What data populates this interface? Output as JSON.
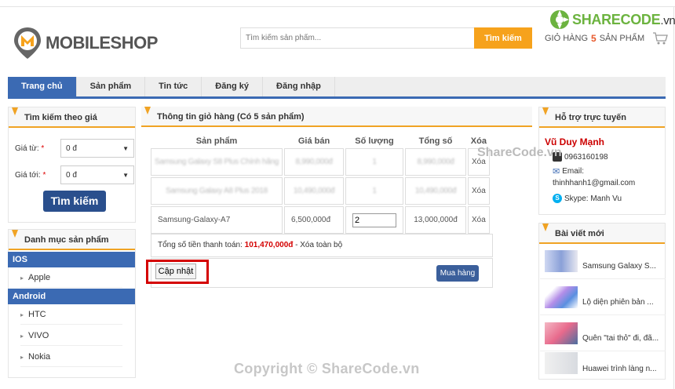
{
  "header": {
    "logo_text": "MOBILESHOP",
    "search_placeholder": "Tìm kiếm sản phẩm...",
    "search_button": "Tìm kiếm",
    "cart_prefix": "GIỎ HÀNG",
    "cart_count": "5",
    "cart_suffix": "SẢN PHẨM"
  },
  "sharecode": {
    "brand": "SHARECODE",
    "tld": ".vn"
  },
  "nav": [
    "Trang chủ",
    "Sản phẩm",
    "Tin tức",
    "Đăng ký",
    "Đăng nhập"
  ],
  "price_search": {
    "title": "Tìm kiếm theo giá",
    "from_label": "Giá từ:",
    "to_label": "Giá tới:",
    "required": "*",
    "from_value": "0 đ",
    "to_value": "0 đ",
    "button": "Tìm kiếm"
  },
  "categories": {
    "title": "Danh mục sản phẩm",
    "groups": [
      {
        "name": "IOS",
        "items": [
          "Apple"
        ]
      },
      {
        "name": "Android",
        "items": [
          "HTC",
          "VIVO",
          "Nokia"
        ]
      }
    ]
  },
  "cart": {
    "title": "Thông tin giỏ hàng (Có 5 sản phẩm)",
    "headers": [
      "Sản phẩm",
      "Giá bán",
      "Số lượng",
      "Tổng số",
      "Xóa"
    ],
    "rows": [
      {
        "product": "Samsung Galaxy S8 Plus Chính hãng",
        "price": "8,990,000đ",
        "qty": "1",
        "total": "8,990,000đ",
        "del": "Xóa"
      },
      {
        "product": "Samsung Galaxy A8 Plus 2018",
        "price": "10,490,000đ",
        "qty": "1",
        "total": "10,490,000đ",
        "del": "Xóa"
      },
      {
        "product": "Samsung-Galaxy-A7",
        "price": "6,500,000đ",
        "qty": "2",
        "total": "13,000,000đ",
        "del": "Xóa"
      }
    ],
    "total_label": "Tổng số tiền thanh toán:",
    "total_value": "101,470,000đ",
    "clear_all": "- Xóa toàn bộ",
    "update_button": "Cập nhật",
    "buy_button": "Mua hàng"
  },
  "support": {
    "title": "Hỗ trợ trực tuyến",
    "name": "Vũ Duy Mạnh",
    "phone": "0963160198",
    "email_label": "Email:",
    "email": "thinhhanh1@gmail.com",
    "skype": "Skype: Manh Vu"
  },
  "news": {
    "title": "Bài viết mới",
    "items": [
      "Samsung Galaxy S...",
      "Lộ diện phiên bản ...",
      "Quên \"tai thỏ\" đi, đã...",
      "Huawei trình làng n..."
    ]
  },
  "watermark": "Copyright © ShareCode.vn",
  "watermark2": "ShareCode.vn"
}
